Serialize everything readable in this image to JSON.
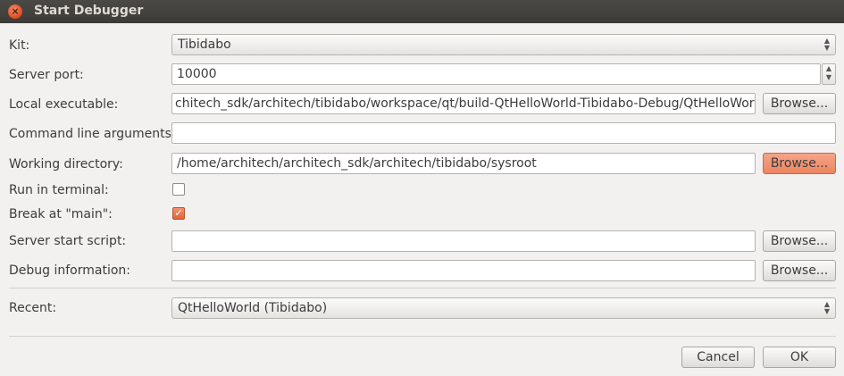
{
  "window": {
    "title": "Start Debugger"
  },
  "form": {
    "kit": {
      "label": "Kit:",
      "value": "Tibidabo"
    },
    "server_port": {
      "label": "Server port:",
      "value": "10000"
    },
    "local_executable": {
      "label": "Local executable:",
      "value": "chitech_sdk/architech/tibidabo/workspace/qt/build-QtHelloWorld-Tibidabo-Debug/QtHelloWorld",
      "browse": "Browse..."
    },
    "command_line_arguments": {
      "label": "Command line arguments:",
      "value": ""
    },
    "working_directory": {
      "label": "Working directory:",
      "value": "/home/architech/architech_sdk/architech/tibidabo/sysroot",
      "browse": "Browse..."
    },
    "run_in_terminal": {
      "label": "Run in terminal:",
      "checked": false
    },
    "break_at_main": {
      "label": "Break at \"main\":",
      "checked": true
    },
    "server_start_script": {
      "label": "Server start script:",
      "value": "",
      "browse": "Browse..."
    },
    "debug_information": {
      "label": "Debug information:",
      "value": "",
      "browse": "Browse..."
    },
    "recent": {
      "label": "Recent:",
      "value": "QtHelloWorld  (Tibidabo)"
    }
  },
  "buttons": {
    "cancel": "Cancel",
    "ok": "OK"
  },
  "colors": {
    "accent": "#ec8560",
    "titlebar": "#3c3b37",
    "background": "#f2f1f0"
  }
}
